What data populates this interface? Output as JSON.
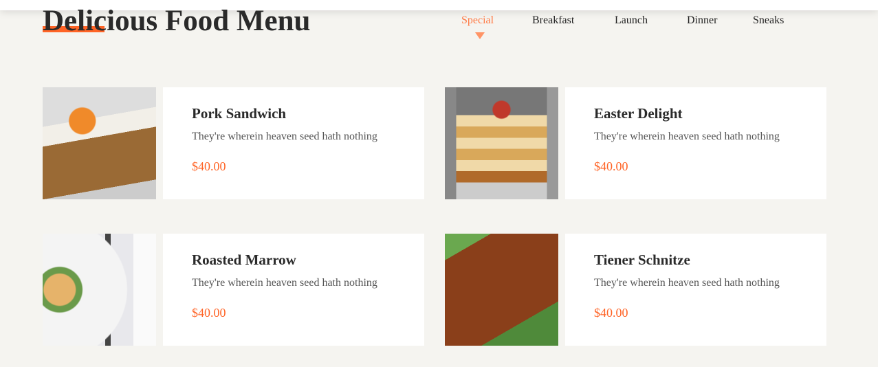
{
  "header": {
    "title": "Delicious Food Menu"
  },
  "nav": {
    "items": [
      "Special",
      "Breakfast",
      "Launch",
      "Dinner",
      "Sneaks"
    ],
    "active": "Special"
  },
  "accent": "#ff6426",
  "menu": [
    {
      "name": "Pork Sandwich",
      "description": "They're wherein heaven seed hath nothing",
      "price": "$40.00"
    },
    {
      "name": "Easter Delight",
      "description": "They're wherein heaven seed hath nothing",
      "price": "$40.00"
    },
    {
      "name": "Roasted Marrow",
      "description": "They're wherein heaven seed hath nothing",
      "price": "$40.00"
    },
    {
      "name": "Tiener Schnitze",
      "description": "They're wherein heaven seed hath nothing",
      "price": "$40.00"
    }
  ]
}
